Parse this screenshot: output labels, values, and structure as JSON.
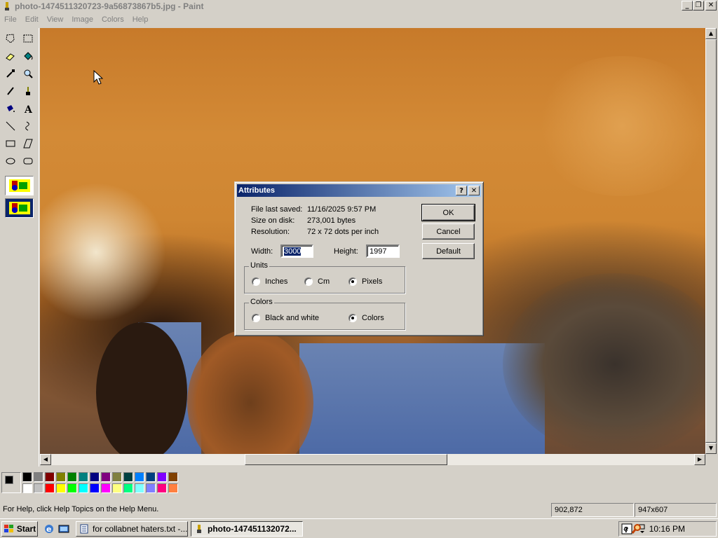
{
  "window": {
    "title": "photo-1474511320723-9a56873867b5.jpg - Paint",
    "buttons": {
      "minimize": "_",
      "restore": "❐",
      "close": "✕"
    }
  },
  "menu": [
    "File",
    "Edit",
    "View",
    "Image",
    "Colors",
    "Help"
  ],
  "tools": [
    {
      "name": "free-select-tool",
      "icon": "free-form-select"
    },
    {
      "name": "rect-select-tool",
      "icon": "rectangle-select"
    },
    {
      "name": "eraser-tool",
      "icon": "eraser"
    },
    {
      "name": "fill-tool",
      "icon": "fill-bucket"
    },
    {
      "name": "pick-color-tool",
      "icon": "eyedropper"
    },
    {
      "name": "magnifier-tool",
      "icon": "magnifier"
    },
    {
      "name": "pencil-tool",
      "icon": "pencil"
    },
    {
      "name": "brush-tool",
      "icon": "brush"
    },
    {
      "name": "airbrush-tool",
      "icon": "airbrush"
    },
    {
      "name": "text-tool",
      "icon": "text-A"
    },
    {
      "name": "line-tool",
      "icon": "line"
    },
    {
      "name": "curve-tool",
      "icon": "curve"
    },
    {
      "name": "rectangle-tool",
      "icon": "rectangle"
    },
    {
      "name": "polygon-tool",
      "icon": "polygon"
    },
    {
      "name": "ellipse-tool",
      "icon": "ellipse"
    },
    {
      "name": "rounded-rect-tool",
      "icon": "rounded-rectangle"
    }
  ],
  "palette": {
    "foreground": "#000000",
    "background": "#ffffff",
    "row1": [
      "#000000",
      "#808080",
      "#800000",
      "#808000",
      "#008000",
      "#008080",
      "#000080",
      "#800080",
      "#808040",
      "#004040",
      "#0080ff",
      "#004080",
      "#8000ff",
      "#804000"
    ],
    "row2": [
      "#ffffff",
      "#c0c0c0",
      "#ff0000",
      "#ffff00",
      "#00ff00",
      "#00ffff",
      "#0000ff",
      "#ff00ff",
      "#ffff80",
      "#00ff80",
      "#80ffff",
      "#8080ff",
      "#ff0080",
      "#ff8040"
    ]
  },
  "status": {
    "help": "For Help, click Help Topics on the Help Menu.",
    "coords": "902,872",
    "size": "947x607"
  },
  "dialog": {
    "title": "Attributes",
    "help_btn": "?",
    "close_btn": "✕",
    "file_last_saved_label": "File last saved:",
    "file_last_saved_value": "11/16/2025 9:57 PM",
    "size_label": "Size on disk:",
    "size_value": "273,001 bytes",
    "resolution_label": "Resolution:",
    "resolution_value": "72 x 72 dots per inch",
    "width_label": "Width:",
    "width_value": "3000",
    "height_label": "Height:",
    "height_value": "1997",
    "units_label": "Units",
    "units": [
      {
        "label": "Inches",
        "selected": false
      },
      {
        "label": "Cm",
        "selected": false
      },
      {
        "label": "Pixels",
        "selected": true
      }
    ],
    "colors_label": "Colors",
    "colors": [
      {
        "label": "Black and white",
        "selected": false
      },
      {
        "label": "Colors",
        "selected": true
      }
    ],
    "ok": "OK",
    "cancel": "Cancel",
    "default": "Default"
  },
  "taskbar": {
    "start": "Start",
    "tasks": [
      {
        "label": "for collabnet haters.txt -...",
        "active": false
      },
      {
        "label": "photo-147451132072...",
        "active": true
      }
    ],
    "tray_collapse": "«",
    "clock": "10:16 PM"
  }
}
